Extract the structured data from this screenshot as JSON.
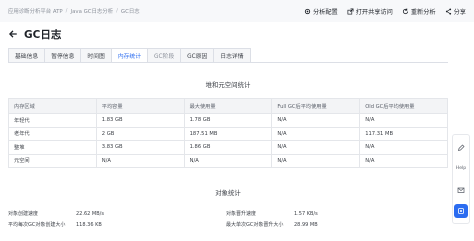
{
  "breadcrumb": [
    "应用诊断分析平台 ATP",
    "Java GC日志分析",
    "GC日志"
  ],
  "header_actions": [
    {
      "label": "分析配置",
      "icon": "gear-icon"
    },
    {
      "label": "打开共享访问",
      "icon": "share-icon"
    },
    {
      "label": "重新分析",
      "icon": "refresh-icon"
    },
    {
      "label": "分享",
      "icon": "share-network-icon"
    }
  ],
  "page_title": "GC日志",
  "tabs": [
    {
      "label": "基础信息",
      "active": false
    },
    {
      "label": "暂停信息",
      "active": false
    },
    {
      "label": "时间图",
      "active": false
    },
    {
      "label": "内存统计",
      "active": true
    },
    {
      "label": "GC阶段",
      "active": false
    },
    {
      "label": "GC原因",
      "active": false
    },
    {
      "label": "日志详情",
      "active": false
    }
  ],
  "heap_section_title": "堆和元空间统计",
  "heap_table": {
    "columns": [
      "内存区域",
      "平均容量",
      "最大使用量",
      "Full GC后平均使用量",
      "Old GC后平均使用量"
    ],
    "rows": [
      [
        "年轻代",
        "1.83 GB",
        "1.78 GB",
        "N/A",
        "N/A"
      ],
      [
        "老年代",
        "2 GB",
        "187.51 MB",
        "N/A",
        "117.31 MB"
      ],
      [
        "整堆",
        "3.83 GB",
        "1.86 GB",
        "N/A",
        "N/A"
      ],
      [
        "元空间",
        "N/A",
        "N/A",
        "N/A",
        "N/A"
      ]
    ]
  },
  "object_section_title": "对象统计",
  "object_stats": [
    [
      {
        "label": "对象创建速度",
        "value": "22.62 MB/s"
      },
      {
        "label": "对象晋升速度",
        "value": "1.57 KB/s"
      }
    ],
    [
      {
        "label": "平均每次GC对象创建大小",
        "value": "118.36 KB"
      },
      {
        "label": "最大单次GC对象晋升大小",
        "value": "28.99 MB"
      }
    ]
  ],
  "side_tools": [
    {
      "icon": "edit-icon"
    },
    {
      "label": "Help"
    },
    {
      "icon": "mail-icon"
    },
    {
      "icon": "app-icon"
    }
  ],
  "colors": {
    "accent": "#2b6cf0",
    "header_bg": "#f7f8fa",
    "table_header_bg": "#f3f4f6"
  }
}
